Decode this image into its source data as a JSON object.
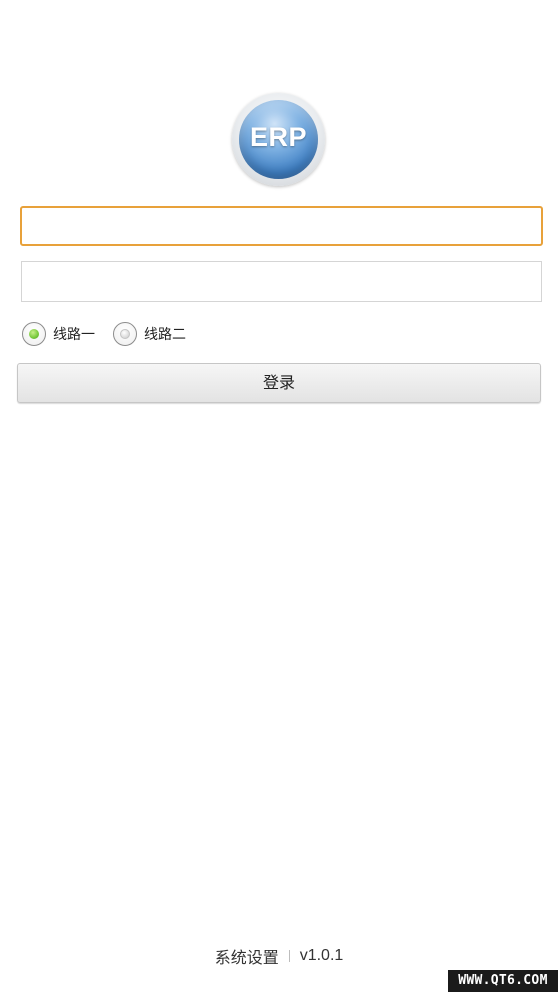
{
  "logo": {
    "text": "ERP"
  },
  "form": {
    "username": {
      "value": "",
      "placeholder": ""
    },
    "password": {
      "value": "",
      "placeholder": ""
    },
    "routes": [
      {
        "label": "线路一",
        "selected": true
      },
      {
        "label": "线路二",
        "selected": false
      }
    ],
    "login_label": "登录"
  },
  "footer": {
    "settings_label": "系统设置",
    "version": "v1.0.1"
  },
  "watermark": {
    "text": "WWW.QT6.COM"
  },
  "colors": {
    "focus_border": "#e8a13a",
    "radio_selected": "#76c83a"
  }
}
